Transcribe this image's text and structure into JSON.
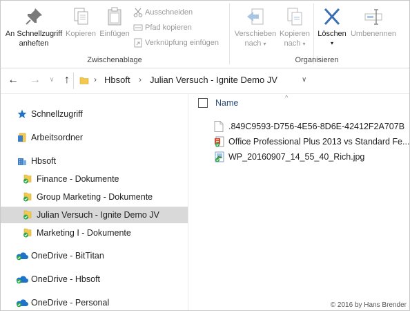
{
  "ribbon": {
    "pin_quick_access": "An Schnellzugriff anheften",
    "copy": "Kopieren",
    "paste": "Einfügen",
    "cut": "Ausschneiden",
    "copy_path": "Pfad kopieren",
    "paste_shortcut": "Verknüpfung einfügen",
    "clipboard_group": "Zwischenablage",
    "move_to": "Verschieben",
    "move_to_sub": "nach",
    "copy_to": "Kopieren",
    "copy_to_sub": "nach",
    "delete": "Löschen",
    "rename": "Umbenennen",
    "organize_group": "Organisieren"
  },
  "breadcrumb": [
    "Hbsoft",
    "Julian Versuch - Ignite Demo JV"
  ],
  "nav": {
    "items": [
      {
        "label": "Schnellzugriff",
        "icon": "star-icon"
      },
      {
        "label": "Arbeitsordner",
        "icon": "work-folders-icon"
      },
      {
        "label": "Hbsoft",
        "icon": "building-icon"
      },
      {
        "label": "Finance - Dokumente",
        "icon": "synced-folder-icon"
      },
      {
        "label": "Group Marketing - Dokumente",
        "icon": "synced-folder-icon"
      },
      {
        "label": "Julian Versuch - Ignite Demo JV",
        "icon": "synced-folder-icon",
        "selected": true
      },
      {
        "label": "Marketing I - Dokumente",
        "icon": "synced-folder-icon"
      },
      {
        "label": "OneDrive - BitTitan",
        "icon": "onedrive-cloud-icon"
      },
      {
        "label": "OneDrive - Hbsoft",
        "icon": "onedrive-cloud-icon"
      },
      {
        "label": "OneDrive - Personal",
        "icon": "onedrive-cloud-icon"
      }
    ]
  },
  "content": {
    "column_name": "Name",
    "files": [
      {
        "name": ".849C9593-D756-4E56-8D6E-42412F2A707B",
        "icon": "blank-file-icon"
      },
      {
        "name": "Office Professional Plus 2013 vs Standard Fe...",
        "icon": "office-document-icon"
      },
      {
        "name": "WP_20160907_14_55_40_Rich.jpg",
        "icon": "image-file-icon"
      }
    ]
  },
  "copyright": "© 2016 by Hans Brender",
  "colors": {
    "selection": "#d9d9d9",
    "accent_blue": "#1e73c8",
    "sync_green": "#2ca84a",
    "folder_yellow": "#f2c94c",
    "disabled_text": "#9a9a9a"
  }
}
